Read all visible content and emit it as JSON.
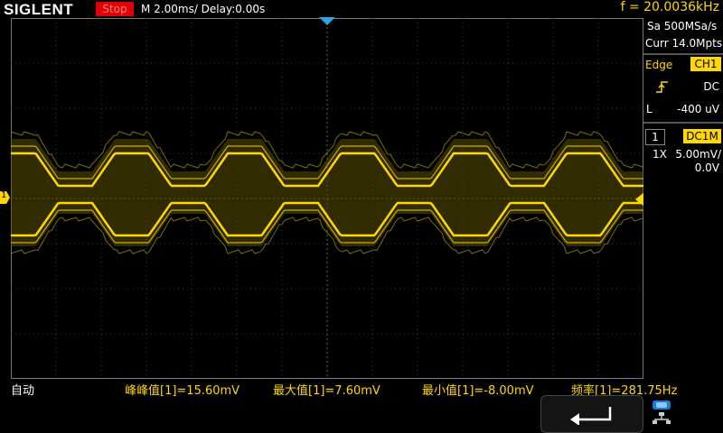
{
  "header": {
    "logo": "SIGLENT",
    "run_state": "Stop",
    "timebase": "M 2.00ms/ Delay:0.00s",
    "frequency": "f = 20.0036kHz"
  },
  "acquire": {
    "sample_rate": "Sa 500MSa/s",
    "memory": "Curr 14.0Mpts"
  },
  "trigger": {
    "type": "Edge",
    "source": "CH1",
    "coupling": "DC",
    "level_label": "L",
    "level": "-400 uV"
  },
  "channel": {
    "number": "1",
    "coupling": "DC1M",
    "probe": "1X",
    "scale": "5.00mV/",
    "offset": "0.0V",
    "marker": "1"
  },
  "measurements": {
    "mode": "自动",
    "items": [
      "峰峰值[1]=15.60mV",
      "最大值[1]=7.60mV",
      "最小值[1]=-8.00mV",
      "频率[1]=281.75Hz"
    ]
  },
  "colors": {
    "trace": "#ffd800",
    "run_state_bg": "#e00000",
    "grid": "#3a3a3a",
    "trigger_marker": "#29a6e8"
  },
  "icons": {
    "back": "back-arrow-icon",
    "network": "network-icon",
    "slope": "rising-edge-icon"
  }
}
